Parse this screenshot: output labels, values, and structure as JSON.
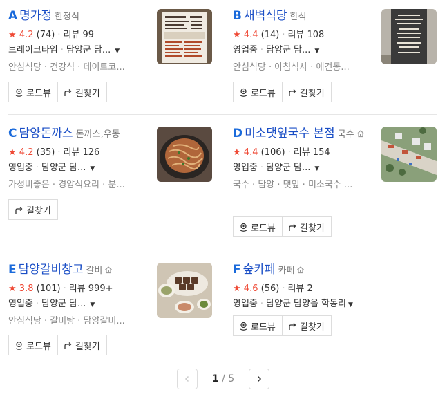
{
  "buttons": {
    "roadview": "로드뷰",
    "directions": "길찾기"
  },
  "labels": {
    "reviews": "리뷰"
  },
  "places": [
    {
      "letter": "A",
      "name": "명가정",
      "category": "한정식",
      "rating": "4.2",
      "rating_count": "(74)",
      "reviews": "99",
      "status": "브레이크타임",
      "address": "담양군 담...",
      "tags": "안심식당 · 건강식 · 데이트코...",
      "thumb": "menu-board-photo"
    },
    {
      "letter": "B",
      "name": "새벽식당",
      "category": "한식",
      "rating": "4.4",
      "rating_count": "(14)",
      "reviews": "108",
      "status": "영업중",
      "address": "담양군 담...",
      "tags": "안심식당 · 아침식사 · 애견동...",
      "thumb": "chalkboard-menu-photo"
    },
    {
      "letter": "C",
      "name": "담양돈까스",
      "category": "돈까스,우동",
      "rating": "4.2",
      "rating_count": "(35)",
      "reviews": "126",
      "status": "영업중",
      "address": "담양군 담...",
      "tags": "가성비좋은 · 경양식요리 · 분...",
      "thumb": "noodle-dish-photo"
    },
    {
      "letter": "D",
      "name": "미소댓잎국수 본점",
      "category": "국수",
      "rating": "4.4",
      "rating_count": "(106)",
      "reviews": "154",
      "status": "영업중",
      "address": "담양군 담...",
      "tags": "국수 · 담양 · 댓잎 · 미소국수 ...",
      "thumb": "aerial-street-photo"
    },
    {
      "letter": "E",
      "name": "담양갈비창고",
      "category": "갈비",
      "rating": "3.8",
      "rating_count": "(101)",
      "reviews": "999+",
      "status": "영업중",
      "address": "담양군 담...",
      "tags": "안심식당 · 갈비탕 · 담양갈비...",
      "thumb": "galbi-table-photo"
    },
    {
      "letter": "F",
      "name": "숲카페",
      "category": "카페",
      "rating": "4.6",
      "rating_count": "(56)",
      "reviews": "2",
      "status": "영업중",
      "address": "담양군 담양읍 학동리",
      "tags": "",
      "thumb": ""
    }
  ],
  "pagination": {
    "current": "1",
    "separator": "/",
    "total": "5"
  },
  "colors": {
    "title": "#1a4ec6",
    "letter": "#1a6adb",
    "star": "#ef4a36"
  }
}
